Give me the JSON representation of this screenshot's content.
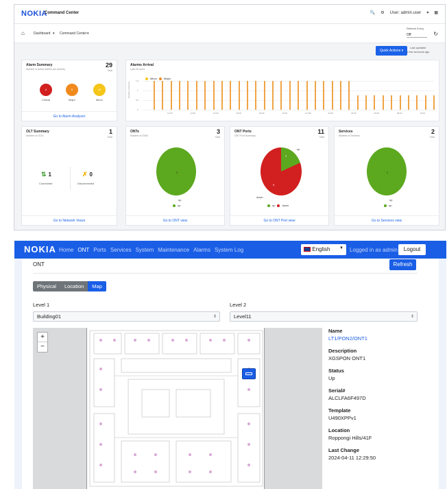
{
  "command_center": {
    "logo": "NOKIA",
    "title": "Command Center",
    "user": "User: admin.user",
    "breadcrumb": [
      "Dashboard",
      "Command Center"
    ],
    "refresh": {
      "label": "Refresh Every",
      "value": "Off"
    },
    "quick_actions": "Quick Actions",
    "last_updated": [
      "Last updated",
      "a few seconds ago"
    ],
    "alarm_summary": {
      "title": "Alarm Summary",
      "subtitle": "Number of active alarms per severity",
      "count": "29",
      "count_sub": "Total",
      "items": [
        {
          "label": "Critical",
          "value": "4",
          "color": "#d21f1f"
        },
        {
          "label": "Major",
          "value": "6",
          "color": "#f08a1c"
        },
        {
          "label": "Minor",
          "value": "19",
          "color": "#f5c518"
        }
      ],
      "link": "Go to Alarm Analyzer"
    },
    "alarms_arrival": {
      "title": "Alarms Arrival",
      "subtitle": "Last 24 hours",
      "ylabel": "Number of Alarms",
      "legend": [
        "Minor",
        "Major"
      ],
      "yticks": [
        "1.5",
        "1",
        "0.5",
        "0"
      ],
      "xticks": [
        "12:00",
        "14:00",
        "16:00",
        "18:00",
        "20:00",
        "22:00",
        "11 Mar",
        "02:00",
        "04:00",
        "06:00",
        "08:00",
        "10:00"
      ]
    },
    "olt_summary": {
      "title": "OLT Summary",
      "subtitle": "Number of OLTs",
      "count": "1",
      "count_sub": "Total",
      "connected": {
        "value": "1",
        "label": "Connected"
      },
      "disconnected": {
        "value": "0",
        "label": "Disconnected"
      },
      "link": "Go to Network Views"
    },
    "onts": {
      "title": "ONTs",
      "subtitle": "Number of ONTs",
      "count": "3",
      "count_sub": "Total",
      "slice_value": "3",
      "slice_label": "up",
      "legend": [
        "up"
      ],
      "link": "Go to ONT view"
    },
    "ont_ports": {
      "title": "ONT Ports",
      "subtitle": "ONT Port Summary",
      "count": "11",
      "count_sub": "Total",
      "up": "2",
      "down": "9",
      "up_label": "up",
      "down_label": "down",
      "legend": [
        "up",
        "down"
      ],
      "link": "Go to ONT Port view"
    },
    "services": {
      "title": "Services",
      "subtitle": "Number of Services",
      "count": "2",
      "count_sub": "Total",
      "slice_value": "2",
      "slice_label": "up",
      "legend": [
        "up"
      ],
      "link": "Go to Services view"
    }
  },
  "ont_app": {
    "logo": "NOKIA",
    "nav": [
      "Home",
      "ONT",
      "Ports",
      "Services",
      "System",
      "Maintenance",
      "Alarms",
      "System Log"
    ],
    "language": "English",
    "logged_in": "Logged in as admin",
    "logout": "Logout",
    "page_title": "ONT",
    "refresh": "Refresh",
    "tabs": [
      "Physical",
      "Location",
      "Map"
    ],
    "level1": {
      "label": "Level 1",
      "value": "Building01"
    },
    "level2": {
      "label": "Level 2",
      "value": "Level11"
    },
    "zoom_in": "+",
    "zoom_out": "−",
    "details": [
      {
        "key": "Name",
        "value": "LT1/PON2/ONT1"
      },
      {
        "key": "Description",
        "value": "XGSPON ONT1"
      },
      {
        "key": "Status",
        "value": "Up"
      },
      {
        "key": "Serial#",
        "value": "ALCLFA6F497D"
      },
      {
        "key": "Template",
        "value": "U490XPPv1"
      },
      {
        "key": "Location",
        "value": "Roppongi Hills/41F"
      },
      {
        "key": "Last Change",
        "value": "2024-04-11 12:29:50"
      }
    ]
  }
}
